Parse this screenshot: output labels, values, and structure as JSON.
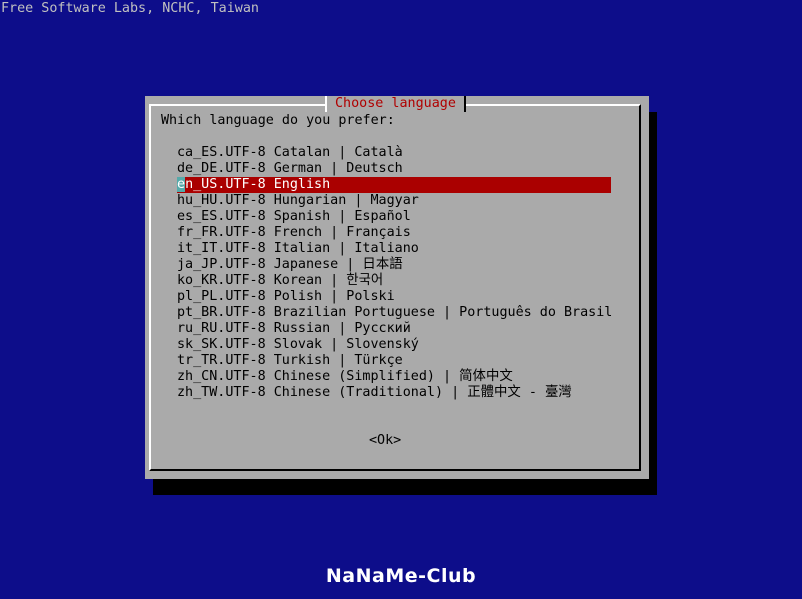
{
  "screen_title": "Free Software Labs, NCHC, Taiwan",
  "dialog": {
    "title": "Choose language",
    "prompt": "Which language do you prefer:",
    "selected_index": 2,
    "languages": [
      {
        "label": "ca_ES.UTF-8 Catalan | Català"
      },
      {
        "label": "de_DE.UTF-8 German | Deutsch"
      },
      {
        "label": "en_US.UTF-8 English"
      },
      {
        "label": "hu_HU.UTF-8 Hungarian | Magyar"
      },
      {
        "label": "es_ES.UTF-8 Spanish | Español"
      },
      {
        "label": "fr_FR.UTF-8 French | Français"
      },
      {
        "label": "it_IT.UTF-8 Italian | Italiano"
      },
      {
        "label": "ja_JP.UTF-8 Japanese | 日本語"
      },
      {
        "label": "ko_KR.UTF-8 Korean | 한국어"
      },
      {
        "label": "pl_PL.UTF-8 Polish | Polski"
      },
      {
        "label": "pt_BR.UTF-8 Brazilian Portuguese | Português do Brasil"
      },
      {
        "label": "ru_RU.UTF-8 Russian | Русский"
      },
      {
        "label": "sk_SK.UTF-8 Slovak | Slovenský"
      },
      {
        "label": "tr_TR.UTF-8 Turkish | Türkçe"
      },
      {
        "label": "zh_CN.UTF-8 Chinese (Simplified) | 简体中文"
      },
      {
        "label": "zh_TW.UTF-8 Chinese (Traditional) | 正體中文 - 臺灣"
      }
    ],
    "ok_label": "<Ok>"
  },
  "footer_logo": "NaNaMe-Club",
  "colors": {
    "background": "#0d0d8a",
    "dialog_bg": "#aaaaaa",
    "title_fg": "#b00000",
    "selection_bg": "#aa0000",
    "cursor_bg": "#55aaaa"
  }
}
